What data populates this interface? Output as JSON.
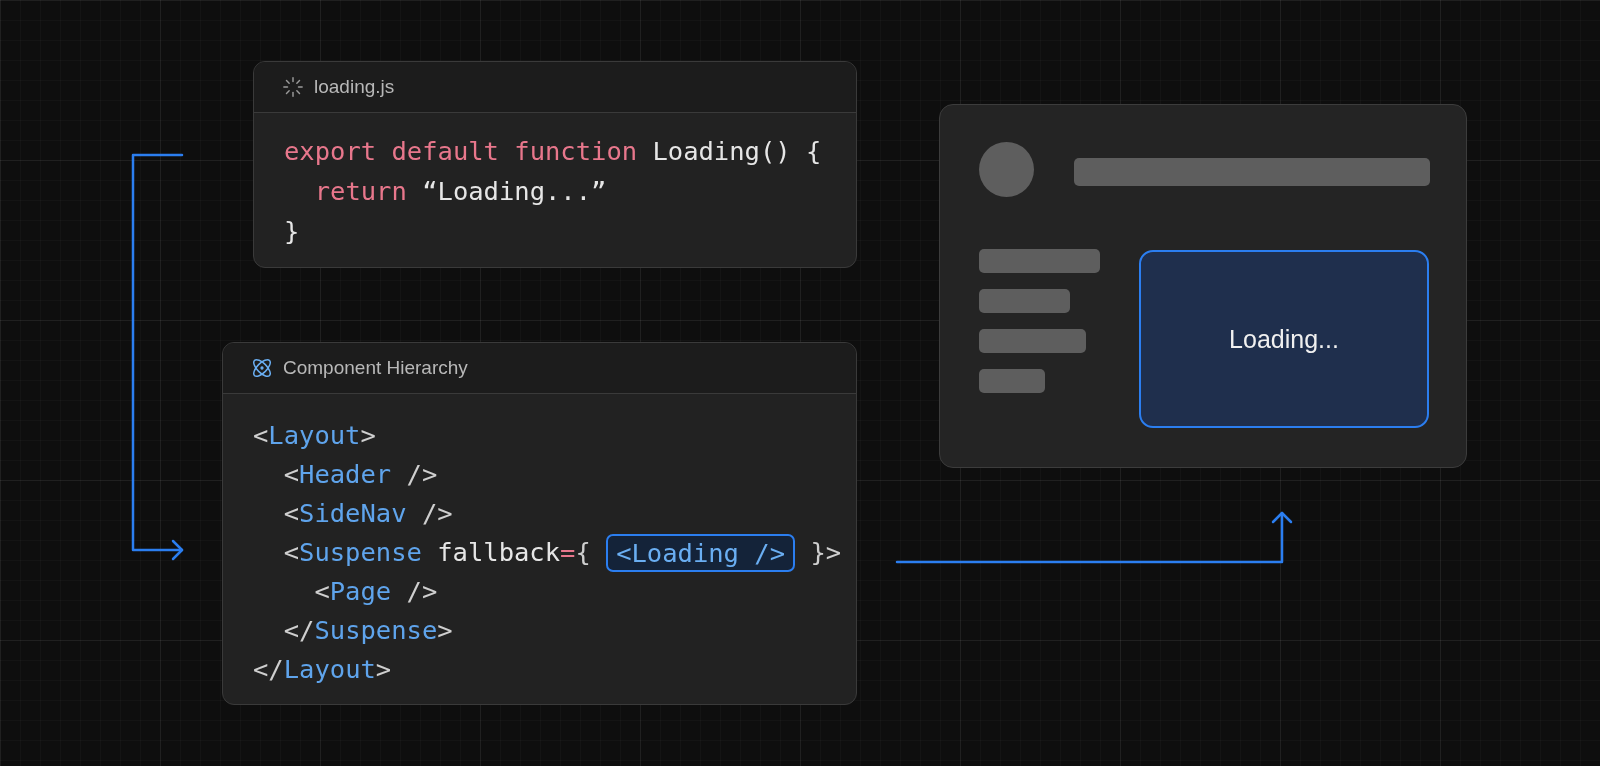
{
  "code_card": {
    "title": "loading.js",
    "lines": [
      [
        {
          "kind": "keyword",
          "text": "export default function"
        },
        {
          "kind": "plain",
          "text": " Loading() {"
        }
      ],
      [
        {
          "kind": "keyword",
          "text": "  return"
        },
        {
          "kind": "plain",
          "text": " “Loading...”"
        }
      ],
      [
        {
          "kind": "plain",
          "text": "}"
        }
      ]
    ]
  },
  "hierarchy_card": {
    "title": "Component Hierarchy",
    "lines": [
      [
        {
          "kind": "punct",
          "text": "<"
        },
        {
          "kind": "tag",
          "text": "Layout"
        },
        {
          "kind": "punct",
          "text": ">"
        }
      ],
      [
        {
          "kind": "punct",
          "text": "  <"
        },
        {
          "kind": "tag",
          "text": "Header"
        },
        {
          "kind": "punct",
          "text": " />"
        }
      ],
      [
        {
          "kind": "punct",
          "text": "  <"
        },
        {
          "kind": "tag",
          "text": "SideNav"
        },
        {
          "kind": "punct",
          "text": " />"
        }
      ],
      [
        {
          "kind": "punct",
          "text": "  <"
        },
        {
          "kind": "tag",
          "text": "Suspense"
        },
        {
          "kind": "plain",
          "text": " fallback"
        },
        {
          "kind": "keyword",
          "text": "="
        },
        {
          "kind": "punct",
          "text": "{ "
        },
        {
          "kind": "highlight",
          "text": "<Loading />"
        },
        {
          "kind": "punct",
          "text": " }>"
        }
      ],
      [
        {
          "kind": "punct",
          "text": "    <"
        },
        {
          "kind": "tag",
          "text": "Page"
        },
        {
          "kind": "punct",
          "text": " />"
        }
      ],
      [
        {
          "kind": "punct",
          "text": "  </"
        },
        {
          "kind": "tag",
          "text": "Suspense"
        },
        {
          "kind": "punct",
          "text": ">"
        }
      ],
      [
        {
          "kind": "punct",
          "text": "</"
        },
        {
          "kind": "tag",
          "text": "Layout"
        },
        {
          "kind": "punct",
          "text": ">"
        }
      ]
    ]
  },
  "preview": {
    "loading_text": "Loading..."
  }
}
